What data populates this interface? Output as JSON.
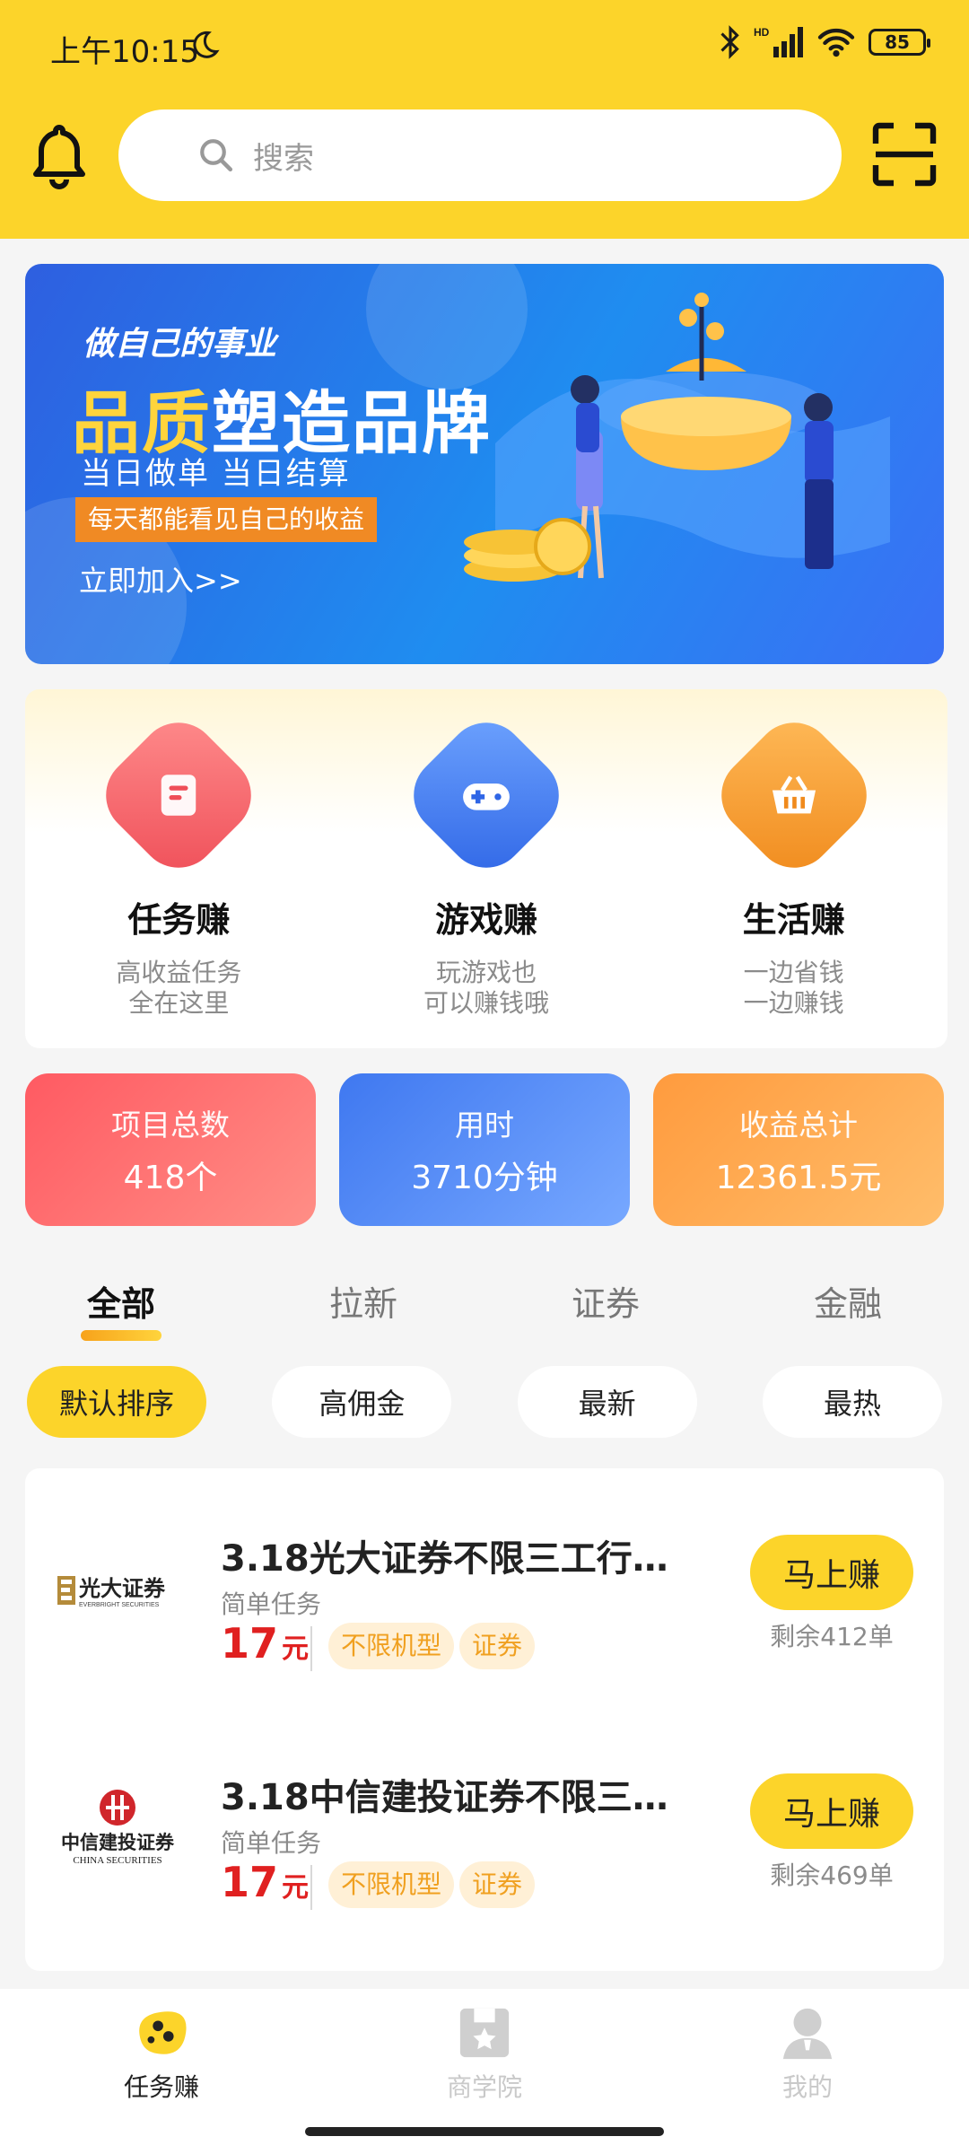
{
  "status": {
    "time": "上午10:15",
    "battery": "85",
    "network": "HD"
  },
  "search": {
    "placeholder": "搜索"
  },
  "banner": {
    "line1": "做自己的事业",
    "line2a": "品质",
    "line2b": "塑造品牌",
    "line3": "当日做单  当日结算",
    "line4": "每天都能看见自己的收益",
    "line5": "立即加入>>"
  },
  "categories": [
    {
      "title": "任务赚",
      "sub1": "高收益任务",
      "sub2": "全在这里",
      "color": "#f0585e"
    },
    {
      "title": "游戏赚",
      "sub1": "玩游戏也",
      "sub2": "可以赚钱哦",
      "color": "#3f7cf0"
    },
    {
      "title": "生活赚",
      "sub1": "一边省钱",
      "sub2": "一边赚钱",
      "color": "#f59a2c"
    }
  ],
  "stats": [
    {
      "label": "项目总数",
      "value": "418个"
    },
    {
      "label": "用时",
      "value": "3710分钟"
    },
    {
      "label": "收益总计",
      "value": "12361.5元"
    }
  ],
  "tabs": [
    "全部",
    "拉新",
    "证券",
    "金融"
  ],
  "sorts": [
    "默认排序",
    "高佣金",
    "最新",
    "最热"
  ],
  "tasks": [
    {
      "title": "3.18光大证券不限三工行…",
      "sub": "简单任务",
      "price": "17",
      "unit": "元",
      "tag1": "不限机型",
      "tag2": "证券",
      "button": "马上赚",
      "remain": "剩余412单",
      "logo_cn": "光大证券",
      "logo_en": "EVERBRIGHT SECURITIES"
    },
    {
      "title": "3.18中信建投证券不限三…",
      "sub": "简单任务",
      "price": "17",
      "unit": "元",
      "tag1": "不限机型",
      "tag2": "证券",
      "button": "马上赚",
      "remain": "剩余469单",
      "logo_cn": "中信建投证券",
      "logo_en": "CHINA SECURITIES"
    }
  ],
  "bottom_nav": [
    "任务赚",
    "商学院",
    "我的"
  ]
}
